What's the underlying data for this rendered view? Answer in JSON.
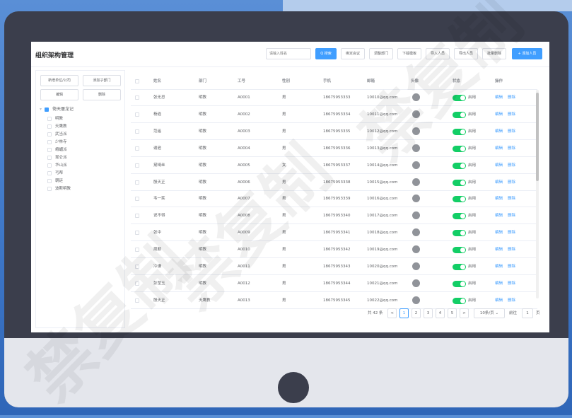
{
  "page_title": "组织架构管理",
  "toolbar": {
    "search_placeholder": "请输入姓名",
    "search_label": "Q 搜索",
    "buttons": [
      "绑定会议",
      "调整部门",
      "下载模板",
      "导入人员",
      "导出人员",
      "批量删除"
    ],
    "add_label": "+ 添加人员"
  },
  "left": {
    "buttons": [
      "新增单位/公司",
      "添加子部门",
      "编辑",
      "删除"
    ],
    "root": "倚天屠龙记",
    "items": [
      "明教",
      "天鹰教",
      "武当派",
      "少林寺",
      "峨嵋派",
      "昆仑派",
      "华山派",
      "丐帮",
      "朝廷",
      "波斯明教"
    ]
  },
  "table": {
    "headers": [
      "姓名",
      "部门",
      "工号",
      "性别",
      "手机",
      "邮箱",
      "头像",
      "状态",
      "操作"
    ],
    "status_label": "启用",
    "edit_label": "编辑",
    "delete_label": "删除",
    "rows": [
      {
        "name": "张无忌",
        "dept": "明教",
        "id": "A0001",
        "gender": "男",
        "phone": "18675953333",
        "email": "10010@qq.com"
      },
      {
        "name": "杨逍",
        "dept": "明教",
        "id": "A0002",
        "gender": "男",
        "phone": "18675953334",
        "email": "10011@qq.com"
      },
      {
        "name": "范遥",
        "dept": "明教",
        "id": "A0003",
        "gender": "男",
        "phone": "18675953335",
        "email": "10012@qq.com"
      },
      {
        "name": "谢逊",
        "dept": "明教",
        "id": "A0004",
        "gender": "男",
        "phone": "18675953336",
        "email": "10013@qq.com"
      },
      {
        "name": "黛绮丝",
        "dept": "明教",
        "id": "A0005",
        "gender": "女",
        "phone": "18675953337",
        "email": "10014@qq.com"
      },
      {
        "name": "殷天正",
        "dept": "明教",
        "id": "A0006",
        "gender": "男",
        "phone": "18675953338",
        "email": "10015@qq.com"
      },
      {
        "name": "韦一笑",
        "dept": "明教",
        "id": "A0007",
        "gender": "男",
        "phone": "18675953339",
        "email": "10016@qq.com"
      },
      {
        "name": "说不得",
        "dept": "明教",
        "id": "A0008",
        "gender": "男",
        "phone": "18675953340",
        "email": "10017@qq.com"
      },
      {
        "name": "张中",
        "dept": "明教",
        "id": "A0009",
        "gender": "男",
        "phone": "18675953341",
        "email": "10018@qq.com"
      },
      {
        "name": "周颠",
        "dept": "明教",
        "id": "A0010",
        "gender": "男",
        "phone": "18675953342",
        "email": "10019@qq.com"
      },
      {
        "name": "冷谦",
        "dept": "明教",
        "id": "A0011",
        "gender": "男",
        "phone": "18675953343",
        "email": "10020@qq.com"
      },
      {
        "name": "彭莹玉",
        "dept": "明教",
        "id": "A0012",
        "gender": "男",
        "phone": "18675953344",
        "email": "10021@qq.com"
      },
      {
        "name": "殷天正",
        "dept": "天鹰教",
        "id": "A0013",
        "gender": "男",
        "phone": "18675953345",
        "email": "10022@qq.com"
      }
    ]
  },
  "pagination": {
    "total": "共 42 条",
    "prev": "<",
    "next": ">",
    "pages": [
      "1",
      "2",
      "3",
      "4",
      "5"
    ],
    "current": "1",
    "page_size": "10条/页",
    "goto_label": "前往",
    "goto_value": "1",
    "page_suffix": "页"
  },
  "watermark": "禁复制",
  "colors": {
    "primary": "#409eff",
    "switch_on": "#13ce66",
    "frame": "#3b3e4c"
  }
}
